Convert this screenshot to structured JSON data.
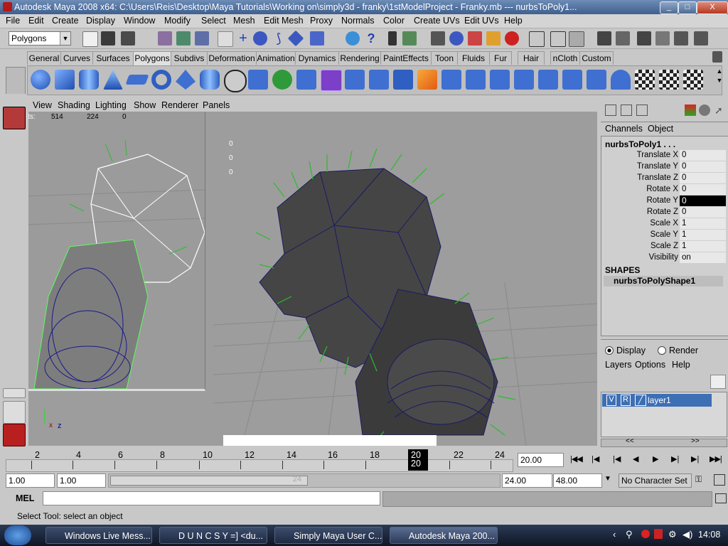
{
  "window": {
    "title": "Autodesk Maya 2008 x64: C:\\Users\\Reis\\Desktop\\Maya Tutorials\\Working on\\simply3d - franky\\1stModelProject - Franky.mb  ---  nurbsToPoly1...",
    "minimize": "_",
    "maximize": "□",
    "close": "X"
  },
  "menubar": [
    "File",
    "Edit",
    "Create",
    "Display",
    "Window",
    "Modify",
    "Select",
    "Mesh",
    "Edit Mesh",
    "Proxy",
    "Normals",
    "Color",
    "Create UVs",
    "Edit UVs",
    "Help"
  ],
  "statusline": {
    "menuset": "Polygons"
  },
  "shelf_tabs": [
    "General",
    "Curves",
    "Surfaces",
    "Polygons",
    "Subdivs",
    "Deformation",
    "Animation",
    "Dynamics",
    "Rendering",
    "PaintEffects",
    "Toon",
    "Fluids",
    "Fur",
    "Hair",
    "nCloth",
    "Custom"
  ],
  "shelf_active_tab": "Polygons",
  "panel_menu": [
    "View",
    "Shading",
    "Lighting",
    "Show",
    "Renderer",
    "Panels"
  ],
  "headsup": {
    "label": "Verts:",
    "v1": "514",
    "v2": "224",
    "v3": "0"
  },
  "hud_numbers": [
    "0",
    "0",
    "0"
  ],
  "channelbox": {
    "tabs": [
      "Channels",
      "Object"
    ],
    "node": "nurbsToPoly1 . . .",
    "attributes": [
      {
        "label": "Translate X",
        "value": "0"
      },
      {
        "label": "Translate Y",
        "value": "0"
      },
      {
        "label": "Translate Z",
        "value": "0"
      },
      {
        "label": "Rotate X",
        "value": "0"
      },
      {
        "label": "Rotate Y",
        "value": "0"
      },
      {
        "label": "Rotate Z",
        "value": "0"
      },
      {
        "label": "Scale X",
        "value": "1"
      },
      {
        "label": "Scale Y",
        "value": "1"
      },
      {
        "label": "Scale Z",
        "value": "1"
      },
      {
        "label": "Visibility",
        "value": "on"
      }
    ],
    "shapes_header": "SHAPES",
    "shape_node": "nurbsToPolyShape1"
  },
  "layers": {
    "display_label": "Display",
    "render_label": "Render",
    "menu": [
      "Layers",
      "Options",
      "Help"
    ],
    "layer_v": "V",
    "layer_r": "R",
    "layer_name": "layer1",
    "nav_prev": "<<",
    "nav_next": ">>"
  },
  "timeline": {
    "ticks": [
      "2",
      "4",
      "6",
      "8",
      "10",
      "12",
      "14",
      "16",
      "18",
      "20",
      "22",
      "24"
    ],
    "current_frame_marker": "20",
    "current_frame_field": "20.00"
  },
  "range": {
    "start": "1.00",
    "inner_start": "1.00",
    "slider_label": "24",
    "inner_end": "24.00",
    "end": "48.00",
    "character_set": "No Character Set"
  },
  "command": {
    "label": "MEL",
    "value": ""
  },
  "help_line": "Select Tool: select an object",
  "taskbar": {
    "items": [
      "Windows Live Mess...",
      "D U N C S Y =] <du...",
      "Simply Maya User C...",
      "Autodesk Maya 200..."
    ],
    "active_index": 3,
    "clock": "14:08"
  },
  "colors": {
    "title_bg": "#3e5f8f",
    "viewport_bg": "#9d9d9d",
    "selected_field": "#000000",
    "layer_highlight": "#3d6fb5"
  }
}
